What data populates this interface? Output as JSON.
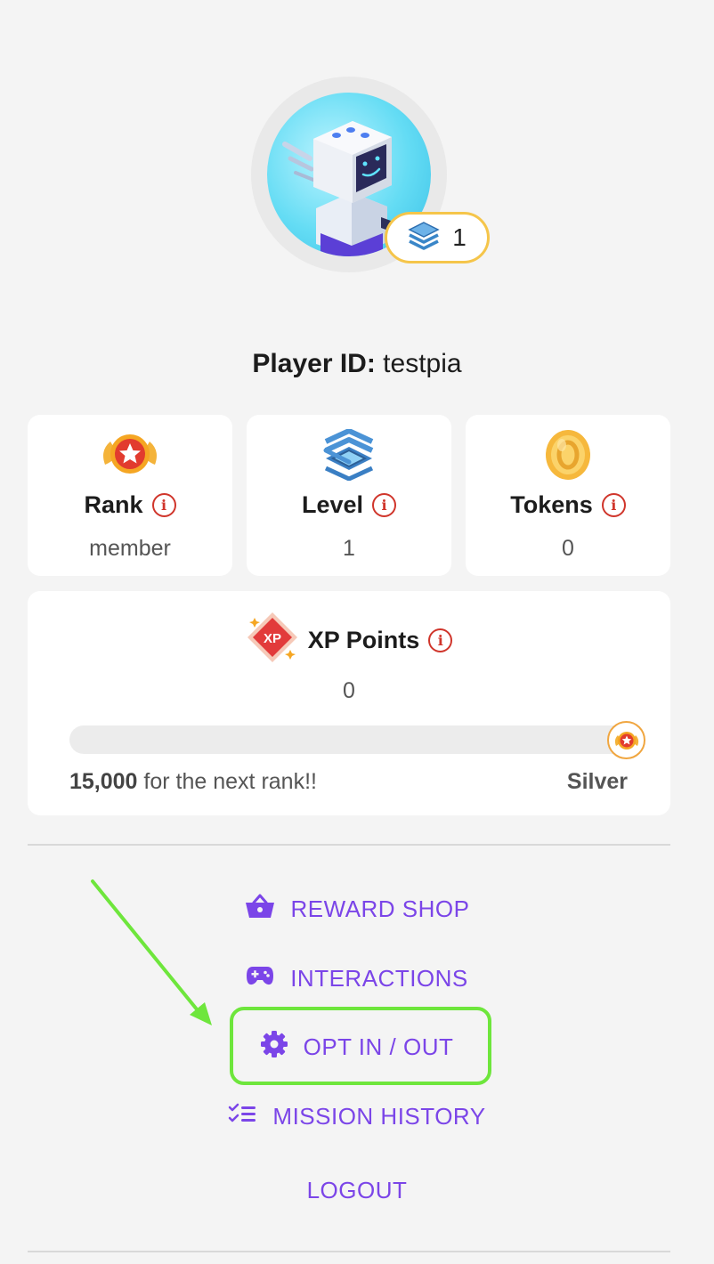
{
  "profile": {
    "level_badge_value": "1",
    "player_id_label": "Player ID:",
    "player_id_value": "testpia"
  },
  "stats": {
    "rank": {
      "label": "Rank",
      "value": "member"
    },
    "level": {
      "label": "Level",
      "value": "1"
    },
    "tokens": {
      "label": "Tokens",
      "value": "0"
    }
  },
  "xp": {
    "label": "XP Points",
    "icon_text": "XP",
    "value": "0",
    "progress_fraction": 0,
    "next_rank_amount": "15,000",
    "next_rank_text": "for the next rank!!",
    "next_rank_name": "Silver"
  },
  "menu": {
    "reward_shop": "REWARD SHOP",
    "interactions": "INTERACTIONS",
    "opt_in_out": "OPT IN / OUT",
    "mission_history": "MISSION HISTORY",
    "logout": "LOGOUT"
  },
  "colors": {
    "accent_purple": "#7b45e8",
    "info_red": "#d0352b",
    "badge_gold": "#f5c54a",
    "annotation_green": "#6ee63c"
  },
  "icons": [
    "robot-avatar-image",
    "level-layers-icon",
    "rank-medal-icon",
    "tokens-coin-icon",
    "xp-diamond-icon",
    "info-icon",
    "basket-icon",
    "gamepad-icon",
    "gear-icon",
    "checklist-icon"
  ]
}
